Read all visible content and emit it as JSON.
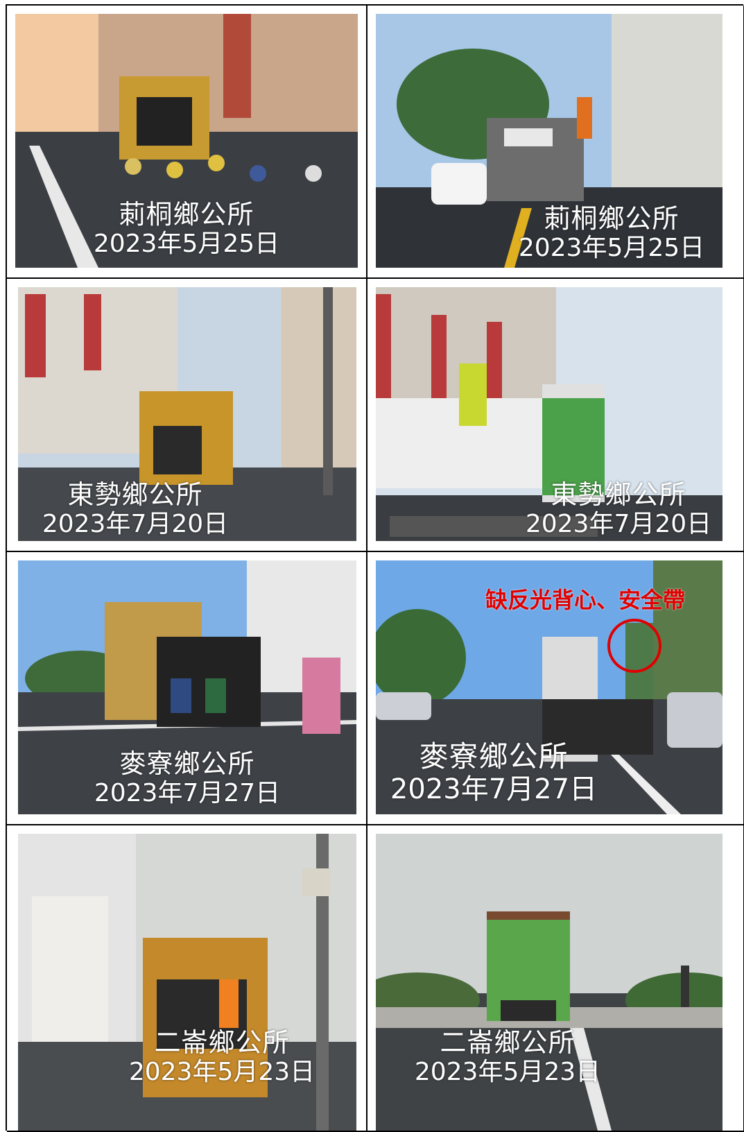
{
  "photos": [
    {
      "office": "莿桐鄉公所",
      "date": "2023年5月25日",
      "sky": "#f2c9a0",
      "road": "#3b3f44",
      "truck": "#c89a32"
    },
    {
      "office": "莿桐鄉公所",
      "date": "2023年5月25日",
      "sky": "#a8c7e6",
      "road": "#2f3338",
      "truck": "#6d6d6d"
    },
    {
      "office": "東勢鄉公所",
      "date": "2023年7月20日",
      "sky": "#c8d6e4",
      "road": "#45484c",
      "truck": "#c8952a"
    },
    {
      "office": "東勢鄉公所",
      "date": "2023年7月20日",
      "sky": "#d7e2ec",
      "road": "#3a3d41",
      "truck": "#e8e8e8"
    },
    {
      "office": "麥寮鄉公所",
      "date": "2023年7月27日",
      "sky": "#7fb1e6",
      "road": "#3e4247",
      "truck": "#c19a4a"
    },
    {
      "office": "麥寮鄉公所",
      "date": "2023年7月27日",
      "sky": "#6ea8e6",
      "road": "#3d4146",
      "truck": "#dcdcdc",
      "annotation": "缺反光背心、安全帶"
    },
    {
      "office": "二崙鄉公所",
      "date": "2023年5月23日",
      "sky": "#d6d8d6",
      "road": "#4a4d50",
      "truck": "#c4892a"
    },
    {
      "office": "二崙鄉公所",
      "date": "2023年5月23日",
      "sky": "#cfd3d2",
      "road": "#3f4346",
      "truck": "#5aa64a"
    }
  ]
}
